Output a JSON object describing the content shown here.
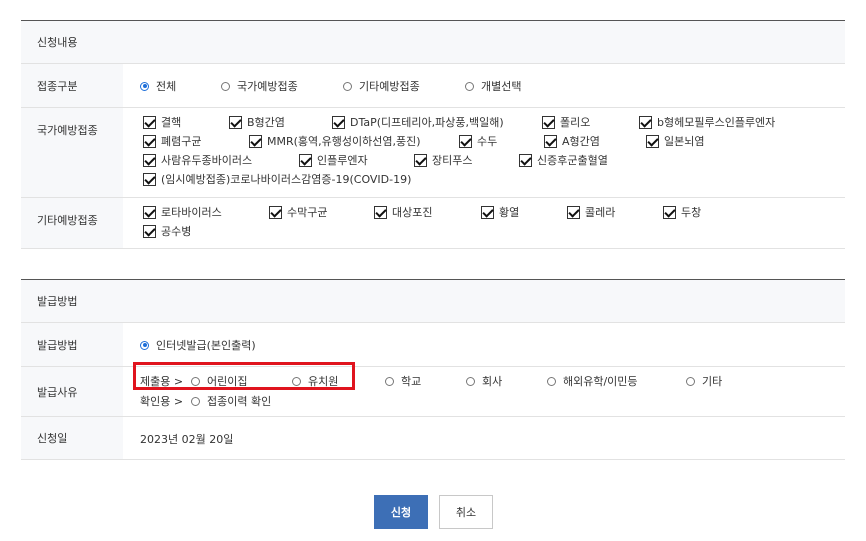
{
  "section1": {
    "title": "신청내용",
    "type_row": {
      "label": "접종구분",
      "options": [
        {
          "label": "전체",
          "selected": true
        },
        {
          "label": "국가예방접종",
          "selected": false
        },
        {
          "label": "기타예방접종",
          "selected": false
        },
        {
          "label": "개별선택",
          "selected": false
        }
      ]
    },
    "national_row": {
      "label": "국가예방접종",
      "items": [
        "결핵",
        "B형간염",
        "DTaP(디프테리아,파상풍,백일해)",
        "폴리오",
        "b형헤모필루스인플루엔자",
        "폐렴구균",
        "MMR(홍역,유행성이하선염,풍진)",
        "수두",
        "A형간염",
        "일본뇌염",
        "사람유두종바이러스",
        "인플루엔자",
        "장티푸스",
        "신증후군출혈열",
        "(임시예방접종)코로나바이러스감염증-19(COVID-19)"
      ]
    },
    "other_row": {
      "label": "기타예방접종",
      "items": [
        "로타바이러스",
        "수막구균",
        "대상포진",
        "황열",
        "콜레라",
        "두창",
        "공수병"
      ]
    }
  },
  "section2": {
    "title": "발급방법",
    "method_row": {
      "label": "발급방법",
      "option": "인터넷발급(본인출력)"
    },
    "reason_row": {
      "label": "발급사유",
      "submit_prefix": "제출용 >",
      "submit_options": [
        "어린이집",
        "유치원",
        "학교",
        "회사",
        "해외유학/이민등",
        "기타"
      ],
      "confirm_prefix": "확인용 >",
      "confirm_options": [
        "접종이력 확인"
      ]
    },
    "date_row": {
      "label": "신청일",
      "value": "2023년 02월 20일"
    }
  },
  "buttons": {
    "apply": "신청",
    "cancel": "취소"
  },
  "colors": {
    "apply_button": "#3d6fb6",
    "highlight": "#e0141e",
    "radio_selected": "#1e6fd9"
  }
}
